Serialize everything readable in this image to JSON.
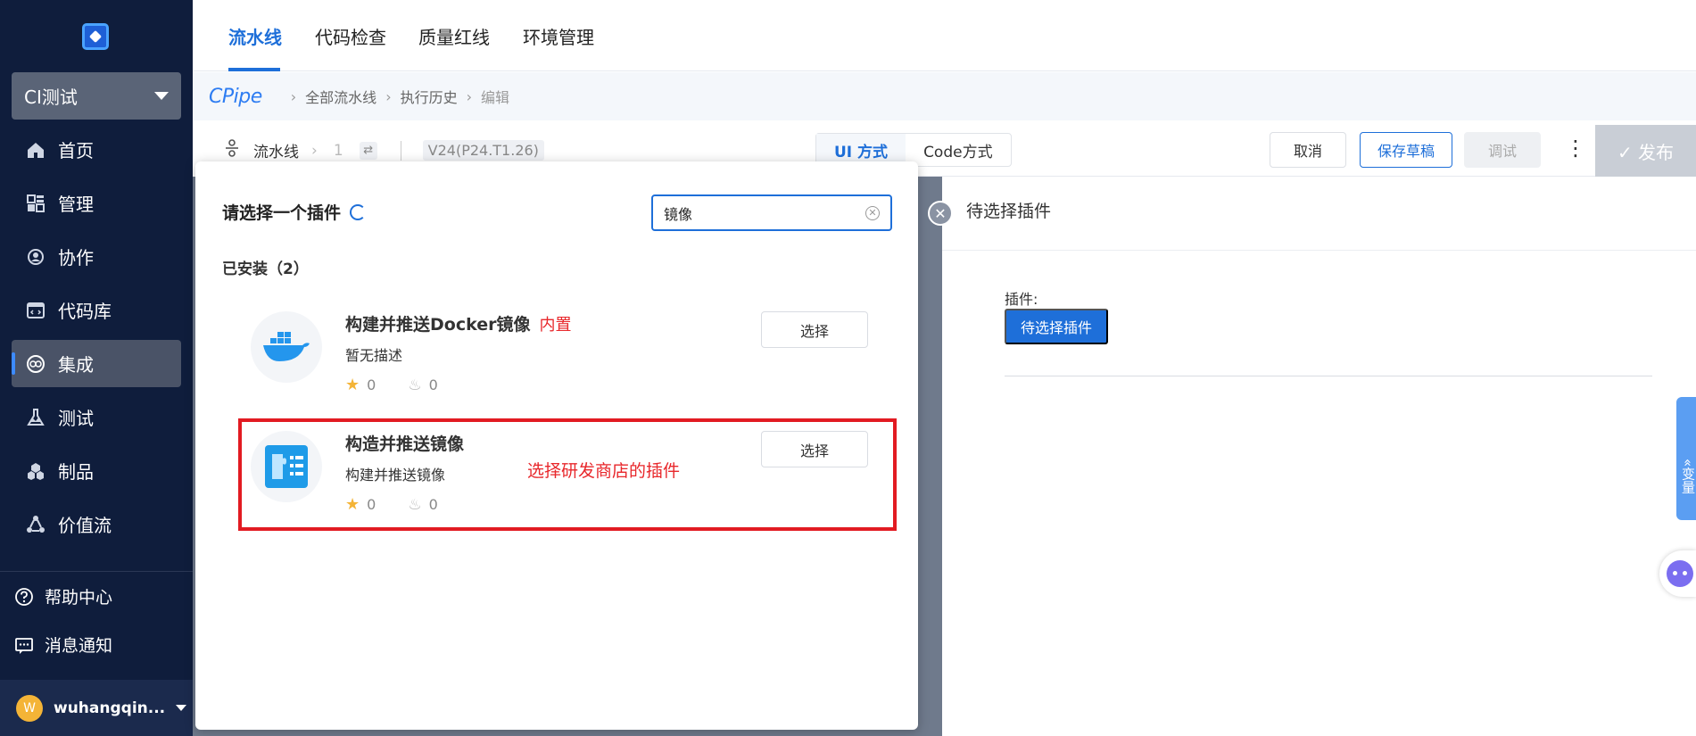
{
  "sidebar": {
    "project": "CI测试",
    "nav": [
      {
        "label": "首页",
        "icon": "home-icon"
      },
      {
        "label": "管理",
        "icon": "grid-icon"
      },
      {
        "label": "协作",
        "icon": "collab-icon"
      },
      {
        "label": "代码库",
        "icon": "code-icon"
      },
      {
        "label": "集成",
        "icon": "integration-icon",
        "active": true
      },
      {
        "label": "测试",
        "icon": "flask-icon"
      },
      {
        "label": "制品",
        "icon": "cubes-icon"
      },
      {
        "label": "价值流",
        "icon": "flow-icon"
      }
    ],
    "help": "帮助中心",
    "notifications": "消息通知",
    "user": {
      "initial": "W",
      "name": "wuhangqin..."
    }
  },
  "tabs": [
    "流水线",
    "代码检查",
    "质量红线",
    "环境管理"
  ],
  "breadcrumb": {
    "brand_c": "C",
    "brand_rest": "Pipe",
    "items": [
      "全部流水线",
      "执行历史",
      "编辑"
    ]
  },
  "toolbar": {
    "pipeline_label": "流水线",
    "number": "1",
    "version": "V24(P24.T1.26)",
    "mode_ui": "UI 方式",
    "mode_code": "Code方式",
    "cancel": "取消",
    "save_draft": "保存草稿",
    "debug": "调试",
    "publish": "✓ 发布"
  },
  "modal": {
    "title": "请选择一个插件",
    "search_value": "镜像",
    "installed_label": "已安装（2）",
    "plugins": [
      {
        "name": "构建并推送Docker镜像",
        "badge": "内置",
        "desc": "暂无描述",
        "stars": "0",
        "hot": "0",
        "select": "选择"
      },
      {
        "name": "构造并推送镜像",
        "badge": "",
        "desc": "构建并推送镜像",
        "stars": "0",
        "hot": "0",
        "select": "选择"
      }
    ],
    "annotation": "选择研发商店的插件"
  },
  "right_panel": {
    "title": "待选择插件",
    "plugin_label": "插件:",
    "pending_button": "待选择插件",
    "vars_tab": "«变量"
  },
  "colors": {
    "sidebar_bg": "#0f1d3c",
    "accent": "#1e6fd9",
    "annotation_red": "#e21b22"
  }
}
